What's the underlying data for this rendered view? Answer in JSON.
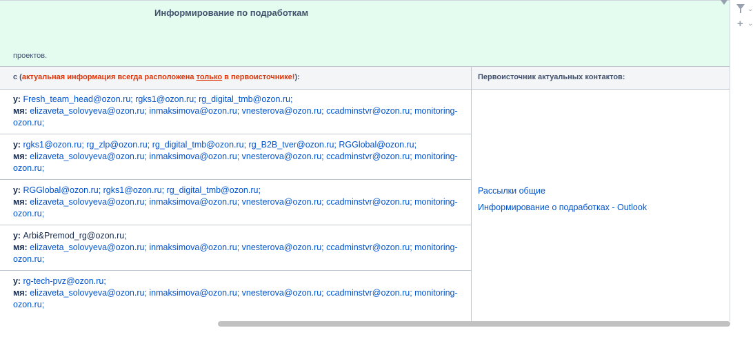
{
  "panel": {
    "title": "Информирование по подработкам",
    "note": "проектов."
  },
  "header": {
    "left_prefix": "с (",
    "left_red_1": "актуальная информация всегда расположена ",
    "left_red_under": "только",
    "left_red_2": " в первоисточнике!",
    "left_suffix": "):",
    "right": "Первоисточник актуальных контактов:"
  },
  "rows": [
    {
      "to_label": "у:",
      "to_value": "Fresh_team_head@ozon.ru; rgks1@ozon.ru; rg_digital_tmb@ozon.ru;",
      "cc_label": "мя:",
      "cc_value": "elizaveta_solovyeva@ozon.ru; inmaksimova@ozon.ru; vnesterova@ozon.ru; ccadminstvr@ozon.ru; monitoring-",
      "cc_cont": "ozon.ru;"
    },
    {
      "to_label": "у:",
      "to_value": "rgks1@ozon.ru; rg_zlp@ozon.ru; rg_digital_tmb@ozon.ru; rg_B2B_tver@ozon.ru; RGGlobal@ozon.ru;",
      "cc_label": "мя:",
      "cc_value": "elizaveta_solovyeva@ozon.ru; inmaksimova@ozon.ru; vnesterova@ozon.ru; ccadminstvr@ozon.ru; monitoring-",
      "cc_cont": "ozon.ru;"
    },
    {
      "to_label": "у:",
      "to_value": "RGGlobal@ozon.ru; rgks1@ozon.ru; rg_digital_tmb@ozon.ru;",
      "cc_label": "мя:",
      "cc_value": "elizaveta_solovyeva@ozon.ru; inmaksimova@ozon.ru; vnesterova@ozon.ru; ccadminstvr@ozon.ru; monitoring-",
      "cc_cont": "ozon.ru;"
    },
    {
      "to_label": "у:",
      "to_value": "Arbi&Premod_rg@ozon.ru;",
      "cc_label": "мя:",
      "cc_value": "elizaveta_solovyeva@ozon.ru; inmaksimova@ozon.ru; vnesterova@ozon.ru; ccadminstvr@ozon.ru; monitoring-",
      "cc_cont": "ozon.ru;"
    },
    {
      "to_label": "у:",
      "to_value": "rg-tech-pvz@ozon.ru;",
      "cc_label": "мя:",
      "cc_value": "elizaveta_solovyeva@ozon.ru; inmaksimova@ozon.ru; vnesterova@ozon.ru; ccadminstvr@ozon.ru; monitoring-",
      "cc_cont": "ozon.ru;"
    }
  ],
  "right_links": [
    "Рассылки общие",
    "Информирование о подработках - Outlook"
  ],
  "icons": [
    "filter-icon",
    "chevron-down-icon",
    "plus-icon"
  ],
  "colors": {
    "panel_bg": "#e3fcef",
    "link": "#0052cc",
    "warning": "#de350b"
  }
}
